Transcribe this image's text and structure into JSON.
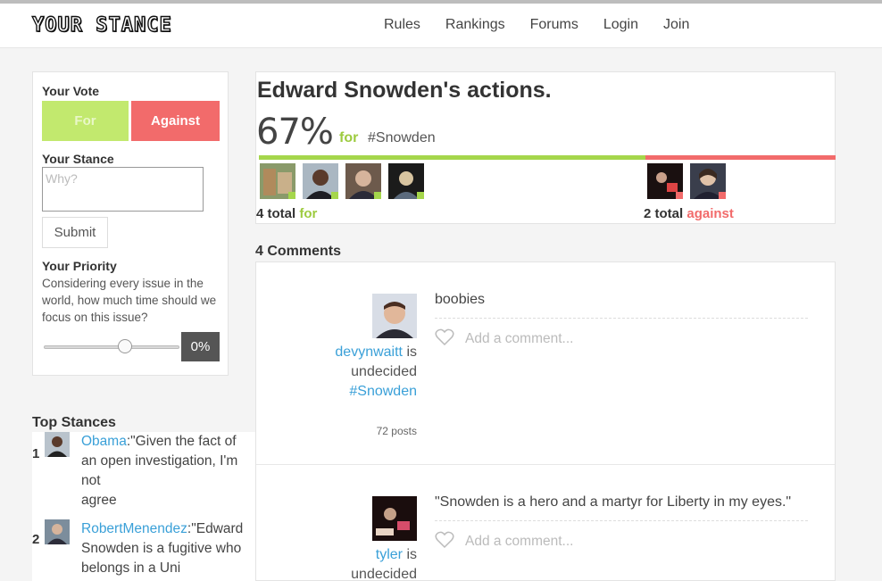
{
  "app": {
    "logo": "YOUR STANCE"
  },
  "nav": {
    "items": [
      "Rules",
      "Rankings",
      "Forums",
      "Login",
      "Join"
    ]
  },
  "vote": {
    "title": "Your Vote",
    "for_label": "For",
    "against_label": "Against",
    "stance_title": "Your Stance",
    "stance_placeholder": "Why?",
    "submit_label": "Submit",
    "priority_title": "Your Priority",
    "priority_desc": "Considering every issue in the world, how much time should we focus on this issue?",
    "priority_value": "0%",
    "slider_level_fraction": 0.6,
    "colors": {
      "for": "#c2e96e",
      "against": "#f26b6b"
    }
  },
  "top_stances": {
    "title": "Top Stances",
    "items": [
      {
        "rank": "1",
        "user": "Obama",
        "text": ":\"Given the fact of an open investigation, I'm not",
        "stance": "agree"
      },
      {
        "rank": "2",
        "user": "RobertMenendez",
        "text": ":\"Edward Snowden is a fugitive who belongs in a Uni",
        "stance": ""
      }
    ]
  },
  "issue": {
    "title": "Edward Snowden's actions.",
    "percent": "67%",
    "percent_side": "for",
    "hashtag": "#Snowden",
    "for_fraction": 0.67,
    "for_total": "4 total",
    "for_word": "for",
    "against_total": "2 total",
    "against_word": "against",
    "for_avatar_count": 4,
    "against_avatar_count": 2
  },
  "comments": {
    "title": "4 Comments",
    "items": [
      {
        "text": "boobies",
        "user": "devynwaitt",
        "is": " is",
        "status": "undecided",
        "tag": "#Snowden",
        "posts": "72 posts",
        "add_comment": "Add a comment..."
      },
      {
        "text": "\"Snowden is a hero and a martyr for Liberty in my eyes.\"",
        "user": "tyler",
        "is": " is",
        "status": "undecided",
        "tag": "",
        "posts": "",
        "add_comment": "Add a comment..."
      }
    ]
  }
}
